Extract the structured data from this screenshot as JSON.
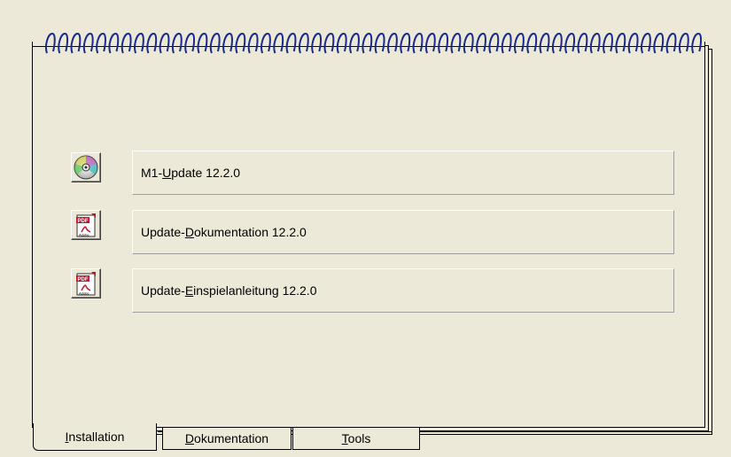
{
  "rows": [
    {
      "icon": "cd-disc-icon",
      "label_prefix": "M1-",
      "label_mnemonic": "U",
      "label_rest": "pdate 12.2.0"
    },
    {
      "icon": "pdf-document-icon",
      "label_prefix": "Update-",
      "label_mnemonic": "D",
      "label_rest": "okumentation 12.2.0"
    },
    {
      "icon": "pdf-document-icon",
      "label_prefix": "Update-",
      "label_mnemonic": "E",
      "label_rest": "inspielanleitung 12.2.0"
    }
  ],
  "tabs": [
    {
      "mnemonic": "I",
      "rest": "nstallation",
      "active": true
    },
    {
      "mnemonic": "D",
      "rest": "okumentation",
      "active": false
    },
    {
      "mnemonic": "T",
      "rest": "ools",
      "active": false
    }
  ],
  "colors": {
    "background": "#ece9d8",
    "spiral": "#1a2a8c",
    "pdf_red": "#c8102e"
  }
}
